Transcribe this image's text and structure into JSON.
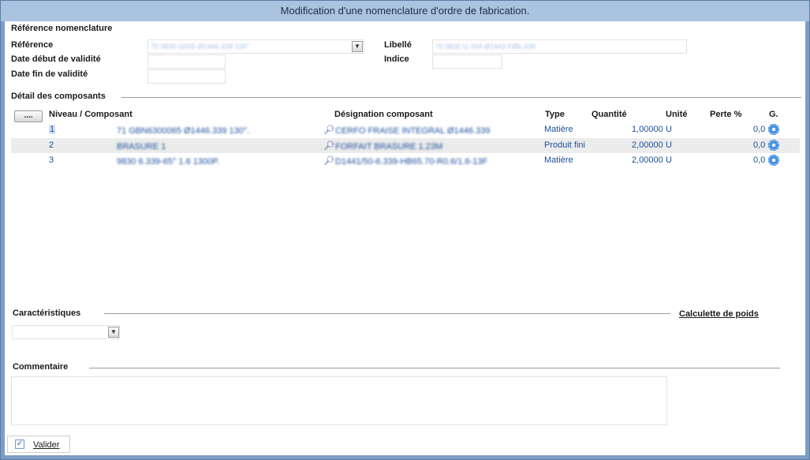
{
  "window": {
    "title": "Modification d'une nomenclature d'ordre de fabrication."
  },
  "reference_section": {
    "title": "Référence nomenclature",
    "reference_label": "Référence",
    "reference_value": "70 9830 G005 Ø1446.339 130°",
    "libelle_label": "Libellé",
    "libelle_value": "70 9830 G 004 Ø1443 FØ6.339",
    "date_debut_label": "Date début de validité",
    "date_debut_value": "",
    "indice_label": "Indice",
    "indice_value": "",
    "date_fin_label": "Date fin de validité",
    "date_fin_value": ""
  },
  "composants": {
    "title": "Détail des composants",
    "more_button": "....",
    "headers": {
      "niveau": "Niveau / Composant",
      "designation": "Désignation composant",
      "type": "Type",
      "quantite": "Quantité",
      "unite": "Unité",
      "perte": "Perte %",
      "g": "G."
    },
    "rows": [
      {
        "niveau": "1",
        "composant": "71 GBN6300065 Ø1446.339 130°.",
        "designation": "CERFO FRAISE INTEGRAL Ø1446.339",
        "type": "Matière",
        "quantite": "1,00000",
        "unite": "U",
        "perte": "",
        "g": "0,0"
      },
      {
        "niveau": "2",
        "composant": "BRASURE 1",
        "designation": "FORFAIT BRASURE 1.23M",
        "type": "Produit fini",
        "quantite": "2,00000",
        "unite": "U",
        "perte": "",
        "g": "0,0"
      },
      {
        "niveau": "3",
        "composant": "9830 6.339-65° 1.6 1300P.",
        "designation": "D1441/50-6.339-HB65.70-R0.6/1.6-13F",
        "type": "Matière",
        "quantite": "2,00000",
        "unite": "U",
        "perte": "",
        "g": "0,0"
      }
    ]
  },
  "caracteristiques": {
    "title": "Caractéristiques",
    "select_value": "",
    "calculette_link": "Calculette de poids"
  },
  "commentaire": {
    "title": "Commentaire",
    "value": ""
  },
  "footer": {
    "valider_label": "Valider"
  },
  "colors": {
    "title_bar": "#a9c3e0",
    "frame": "#7d9ec4",
    "link_text": "#1c4f9c",
    "alt_row": "#ececec"
  }
}
